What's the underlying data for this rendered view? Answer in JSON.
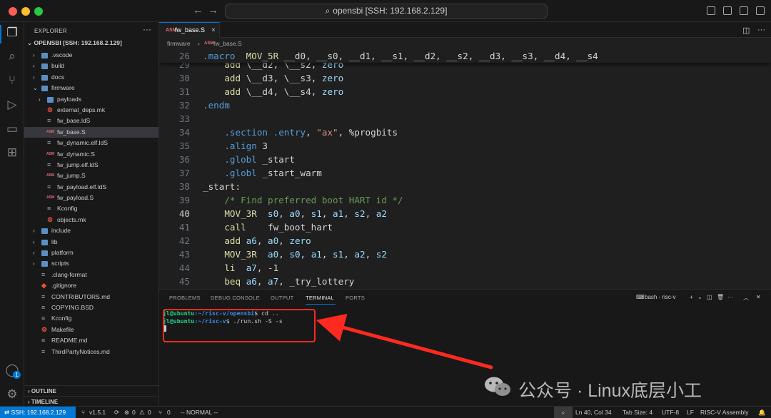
{
  "titlebar": {
    "back_icon": "arrow-left-icon",
    "forward_icon": "arrow-right-icon",
    "command_center": "opensbi [SSH: 192.168.2.129]"
  },
  "activity_bar": {
    "items": [
      "files-icon",
      "search-icon",
      "source-control-icon",
      "run-debug-icon",
      "remote-explorer-icon",
      "extensions-icon"
    ],
    "account_badge": "1"
  },
  "sidebar": {
    "title": "EXPLORER",
    "more": "···",
    "root": "OPENSBI [SSH: 192.168.2.129]",
    "items": [
      {
        "label": ".vscode",
        "kind": "folder",
        "depth": 0
      },
      {
        "label": "build",
        "kind": "folder",
        "depth": 0
      },
      {
        "label": "docs",
        "kind": "folder",
        "depth": 0
      },
      {
        "label": "firmware",
        "kind": "folder-open",
        "depth": 0
      },
      {
        "label": "payloads",
        "kind": "folder",
        "depth": 1
      },
      {
        "label": "external_deps.mk",
        "kind": "gear",
        "depth": 1
      },
      {
        "label": "fw_base.ldS",
        "kind": "ld",
        "depth": 1
      },
      {
        "label": "fw_base.S",
        "kind": "asm",
        "depth": 1
      },
      {
        "label": "fw_dynamic.elf.ldS",
        "kind": "ld",
        "depth": 1
      },
      {
        "label": "fw_dynamic.S",
        "kind": "asm",
        "depth": 1
      },
      {
        "label": "fw_jump.elf.ldS",
        "kind": "ld",
        "depth": 1
      },
      {
        "label": "fw_jump.S",
        "kind": "asm",
        "depth": 1
      },
      {
        "label": "fw_payload.elf.ldS",
        "kind": "ld",
        "depth": 1
      },
      {
        "label": "fw_payload.S",
        "kind": "asm",
        "depth": 1
      },
      {
        "label": "Kconfig",
        "kind": "lines",
        "depth": 1
      },
      {
        "label": "objects.mk",
        "kind": "gear",
        "depth": 1
      },
      {
        "label": "include",
        "kind": "folder",
        "depth": 0
      },
      {
        "label": "lib",
        "kind": "folder",
        "depth": 0
      },
      {
        "label": "platform",
        "kind": "folder",
        "depth": 0
      },
      {
        "label": "scripts",
        "kind": "folder",
        "depth": 0
      },
      {
        "label": ".clang-format",
        "kind": "lines",
        "depth": 0
      },
      {
        "label": ".gitignore",
        "kind": "git",
        "depth": 0
      },
      {
        "label": "CONTRIBUTORS.md",
        "kind": "lines",
        "depth": 0
      },
      {
        "label": "COPYING.BSD",
        "kind": "lines",
        "depth": 0
      },
      {
        "label": "Kconfig",
        "kind": "lines",
        "depth": 0
      },
      {
        "label": "Makefile",
        "kind": "gear",
        "depth": 0
      },
      {
        "label": "README.md",
        "kind": "lines",
        "depth": 0
      },
      {
        "label": "ThirdPartyNotices.md",
        "kind": "lines",
        "depth": 0
      }
    ],
    "selected_index": 7,
    "outline": "OUTLINE",
    "timeline": "TIMELINE"
  },
  "editor": {
    "tab_label": "fw_base.S",
    "tab_close": "×",
    "breadcrumb": [
      "firmware",
      "fw_base.S"
    ],
    "breadcrumb_sep": "›",
    "file_icon_text": "ASM",
    "sticky_line": {
      "num": "26",
      "text": ".macro  MOV_5R __d0, __s0, __d1, __s1, __d2, __s2, __d3, __s3, __d4, __s4"
    },
    "current_line": "40",
    "lines": [
      {
        "num": "29",
        "text": "    add \\__d2, \\__s2, zero"
      },
      {
        "num": "30",
        "text": "    add \\__d3, \\__s3, zero"
      },
      {
        "num": "31",
        "text": "    add \\__d4, \\__s4, zero"
      },
      {
        "num": "32",
        "text": ".endm"
      },
      {
        "num": "33",
        "text": ""
      },
      {
        "num": "34",
        "text": "    .section .entry, \"ax\", %progbits"
      },
      {
        "num": "35",
        "text": "    .align 3"
      },
      {
        "num": "36",
        "text": "    .globl _start"
      },
      {
        "num": "37",
        "text": "    .globl _start_warm"
      },
      {
        "num": "38",
        "text": "_start:"
      },
      {
        "num": "39",
        "text": "    /* Find preferred boot HART id */"
      },
      {
        "num": "40",
        "text": "    MOV_3R  s0, a0, s1, a1, s2, a2"
      },
      {
        "num": "41",
        "text": "    call    fw_boot_hart"
      },
      {
        "num": "42",
        "text": "    add a6, a0, zero"
      },
      {
        "num": "43",
        "text": "    MOV_3R  a0, s0, a1, s1, a2, s2"
      },
      {
        "num": "44",
        "text": "    li  a7, -1"
      },
      {
        "num": "45",
        "text": "    beq a6, a7, _try_lottery"
      }
    ]
  },
  "panel": {
    "tabs": [
      "PROBLEMS",
      "DEBUG CONSOLE",
      "OUTPUT",
      "TERMINAL",
      "PORTS"
    ],
    "active_tab": "TERMINAL",
    "terminal_name": "bash - risc-v",
    "terminal": {
      "line1_user": "jl@ubuntu",
      "line1_path": ":~/risc-v/opensbi",
      "line1_cmd": "$ cd ..",
      "line2_user": "jl@ubuntu",
      "line2_path": ":~/risc-v",
      "line2_cmd": "$ ./run.sh -S -s"
    },
    "annotation_color": "#ff2a1f"
  },
  "watermark": {
    "text": "公众号 · Linux底层小工"
  },
  "statusbar": {
    "remote": "SSH: 192.168.2.129",
    "branch": "v1.5.1",
    "errors": "0",
    "warnings": "0",
    "ports": "0",
    "mode": "-- NORMAL --",
    "position": "Ln 40, Col 34",
    "tab_size": "Tab Size: 4",
    "encoding": "UTF-8",
    "eol": "LF",
    "language": "RISC-V Assembly"
  },
  "colors": {
    "accent": "#0078d4",
    "keyword": "#569cd6",
    "comment": "#6a9955",
    "string": "#ce9178",
    "variable": "#9cdcfe"
  }
}
